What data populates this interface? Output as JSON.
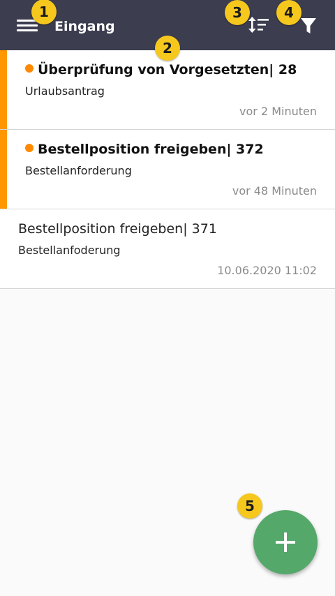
{
  "header": {
    "title": "Eingang",
    "menu_icon": "hamburger-menu-icon",
    "sort_icon": "sort-icon",
    "filter_icon": "filter-icon",
    "background_color": "#3c3d4f"
  },
  "badges": [
    "1",
    "2",
    "3",
    "4",
    "5"
  ],
  "items": [
    {
      "title": "Überprüfung von Vorgesetzten| 28",
      "subtitle": "Urlaubsantrag",
      "time": "vor 2 Minuten",
      "unread": true
    },
    {
      "title": "Bestellposition freigeben| 372",
      "subtitle": "Bestellanforderung",
      "time": "vor 48 Minuten",
      "unread": true
    },
    {
      "title": "Bestellposition freigeben| 371",
      "subtitle": "Bestellanfoderung",
      "time": "10.06.2020 11:02",
      "unread": false
    }
  ],
  "fab": {
    "icon": "plus-icon",
    "color": "#54a86a"
  },
  "colors": {
    "accent_unread": "#ff9800",
    "badge": "#f6c81e"
  }
}
